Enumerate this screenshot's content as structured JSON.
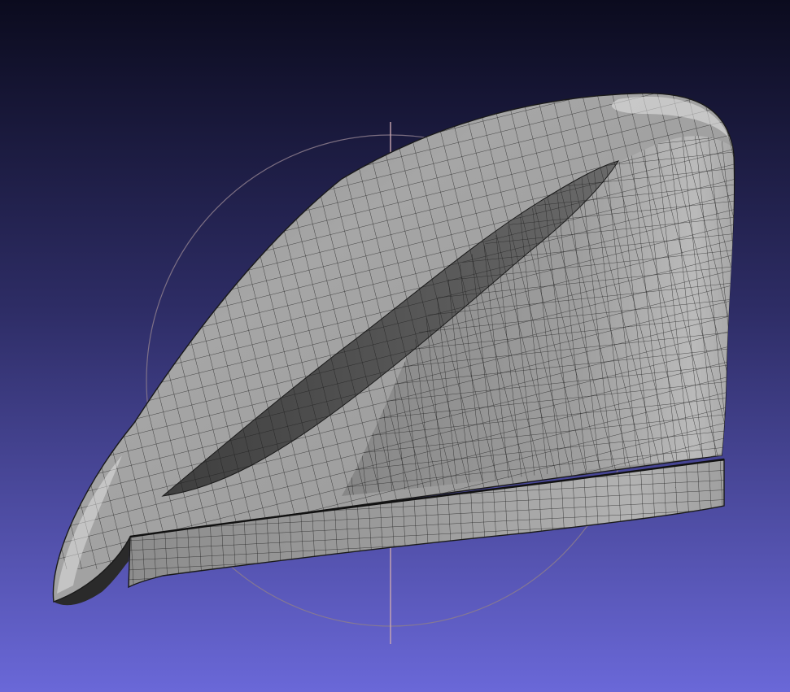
{
  "app": {
    "kind": "3d-mesh-viewer"
  },
  "viewport": {
    "background_top": "#0b0b1e",
    "background_bottom": "#6a68d8",
    "trackball_color": "#8c7c8c",
    "trackball_axis_color": "#c8a7b0",
    "mesh": {
      "object": "beret-hat",
      "render_mode": "flat-shaded-with-wireframe",
      "fill_light": "#b5b5b5",
      "fill_mid": "#959595",
      "fill_dark": "#555555",
      "edge_color": "#1a1a1a"
    }
  }
}
